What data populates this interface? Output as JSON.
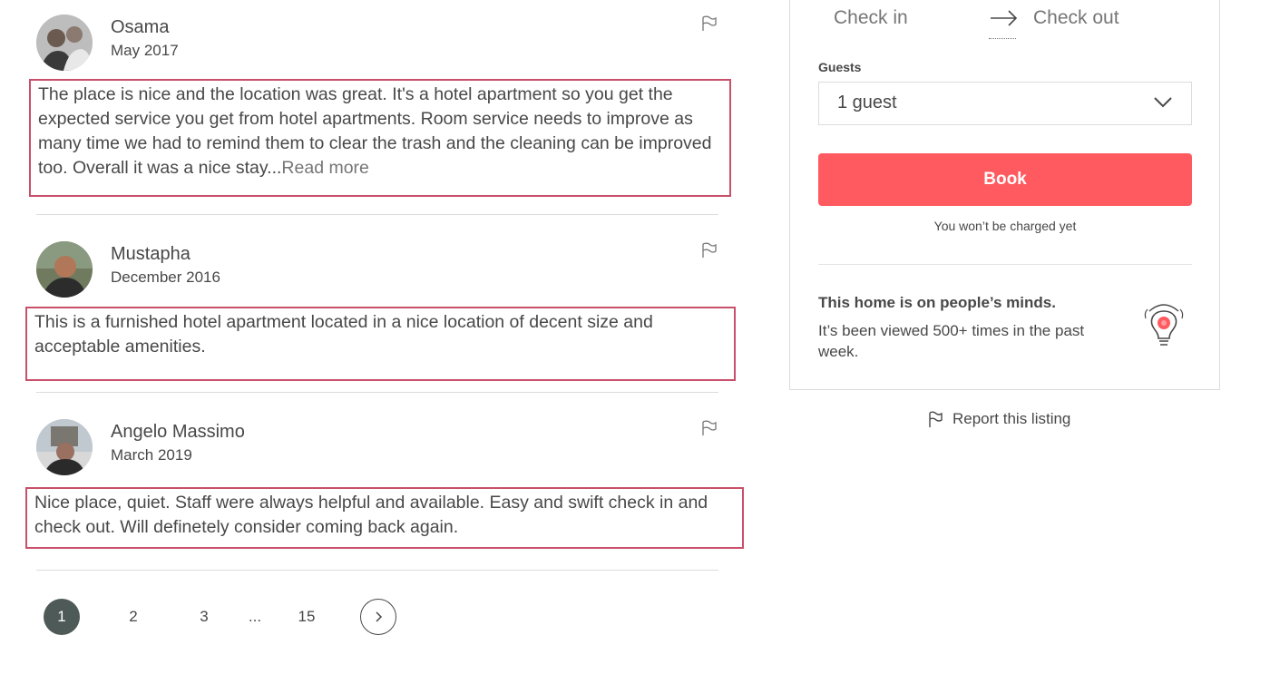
{
  "reviews": [
    {
      "name": "Osama",
      "date": "May 2017",
      "text": "The place is nice and the location was great. It's a hotel apartment so you get the expected service you get from hotel apartments. Room service needs to improve as many time we had to remind them to clear the trash and the cleaning can be improved too. Overall it was a nice stay...",
      "read_more": "Read more"
    },
    {
      "name": "Mustapha",
      "date": "December 2016",
      "text": "This is a furnished hotel apartment located in a nice location of decent size and acceptable amenities."
    },
    {
      "name": "Angelo Massimo",
      "date": "March 2019",
      "text": "Nice place, quiet. Staff were always helpful and available. Easy and swift check in and check out. Will definetely consider coming back again."
    }
  ],
  "pagination": {
    "pages": [
      "1",
      "2",
      "3",
      "...",
      "15"
    ],
    "current": "1"
  },
  "booking": {
    "check_in": "Check in",
    "check_out": "Check out",
    "guests_label": "Guests",
    "guests_value": "1 guest",
    "book_label": "Book",
    "charge_note": "You won’t be charged yet",
    "minds_title": "This home is on people’s minds.",
    "minds_body": "It’s been viewed 500+ times in the past week."
  },
  "report_label": "Report this listing",
  "colors": {
    "accent": "#ff5a5f",
    "highlight_border": "#c8506a",
    "active_page": "#4e5a58",
    "text": "#484848"
  }
}
